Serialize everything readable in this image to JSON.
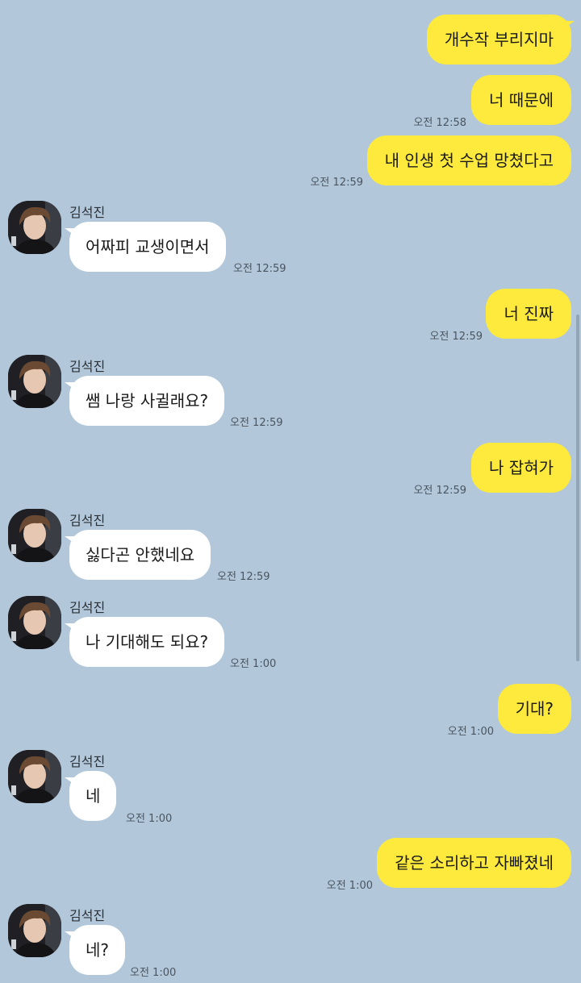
{
  "contact": {
    "name": "김석진"
  },
  "messages": [
    {
      "side": "out",
      "text": "개수작 부리지마",
      "time": ""
    },
    {
      "side": "out",
      "text": "너 때문에",
      "time": "오전 12:58"
    },
    {
      "side": "out",
      "text": "내 인생 첫 수업 망쳤다고",
      "time": "오전 12:59"
    },
    {
      "side": "in",
      "text": "어짜피 교생이면서",
      "time": "오전 12:59"
    },
    {
      "side": "out",
      "text": "너 진짜",
      "time": "오전 12:59"
    },
    {
      "side": "in",
      "text": "쌤 나랑 사귈래요?",
      "time": "오전 12:59"
    },
    {
      "side": "out",
      "text": "나 잡혀가",
      "time": "오전 12:59"
    },
    {
      "side": "in",
      "text": "싫다곤 안했네요",
      "time": "오전 12:59"
    },
    {
      "side": "in",
      "text": "나 기대해도 되요?",
      "time": "오전 1:00"
    },
    {
      "side": "out",
      "text": "기대?",
      "time": "오전 1:00"
    },
    {
      "side": "in",
      "text": "네",
      "time": "오전 1:00"
    },
    {
      "side": "out",
      "text": "같은 소리하고 자빠졌네",
      "time": "오전 1:00"
    },
    {
      "side": "in",
      "text": "네?",
      "time": "오전 1:00"
    }
  ],
  "colors": {
    "background": "#b2c7da",
    "outgoing_bubble": "#fee93d",
    "incoming_bubble": "#ffffff"
  },
  "icons": {
    "avatar": "profile-photo-avatar"
  }
}
